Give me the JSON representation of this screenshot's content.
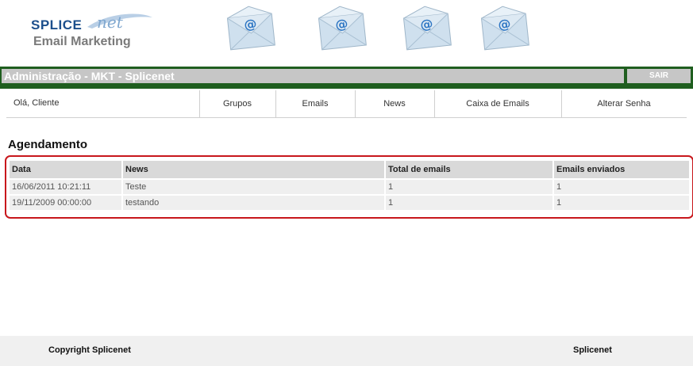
{
  "header": {
    "logo_brand": "SPLICE",
    "logo_brand_suffix": "net",
    "logo_subtitle": "Email Marketing",
    "envelope_icons": [
      "email-envelope-icon",
      "email-envelope-icon",
      "email-envelope-icon",
      "email-envelope-icon"
    ]
  },
  "titlebar": {
    "title": "Administração - MKT - Splicenet",
    "logout_label": "SAIR"
  },
  "nav": {
    "greeting": "Olá, Cliente",
    "items": [
      "Grupos",
      "Emails",
      "News",
      "Caixa de Emails",
      "Alterar Senha"
    ]
  },
  "main": {
    "section_title": "Agendamento",
    "table": {
      "headers": [
        "Data",
        "News",
        "Total de emails",
        "Emails enviados"
      ],
      "rows": [
        [
          "16/06/2011 10:21:11",
          "Teste",
          "1",
          "1"
        ],
        [
          "19/11/2009 00:00:00",
          "testando",
          "1",
          "1"
        ]
      ]
    }
  },
  "footer": {
    "copyright": "Copyright Splicenet",
    "brand": "Splicenet"
  },
  "colors": {
    "titlebar_green": "#1f5e1f",
    "panel_border_red": "#c8171c",
    "logo_blue": "#1c4f8c"
  }
}
